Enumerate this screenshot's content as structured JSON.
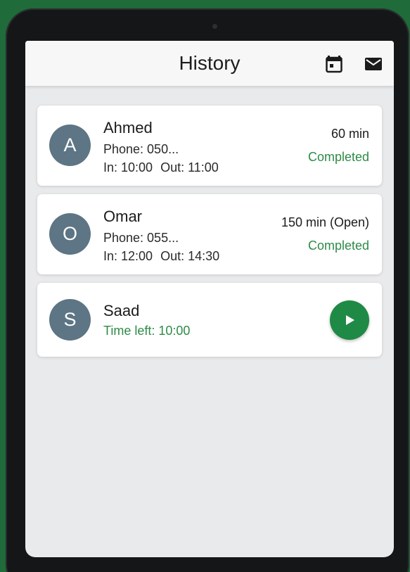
{
  "header": {
    "title": "History",
    "icons": [
      "calendar-icon",
      "mail-icon"
    ]
  },
  "history": [
    {
      "initial": "A",
      "name": "Ahmed",
      "phone": "Phone: 050...",
      "in": "In: 10:00",
      "out": "Out: 11:00",
      "duration": "60 min",
      "status": "Completed"
    },
    {
      "initial": "O",
      "name": "Omar",
      "phone": "Phone: 055...",
      "in": "In: 12:00",
      "out": "Out: 14:30",
      "duration": "150 min (Open)",
      "status": "Completed"
    }
  ],
  "active": {
    "initial": "S",
    "name": "Saad",
    "time_left": "Time left: 10:00",
    "action_icon": "play-icon"
  },
  "colors": {
    "accent_green": "#1f8a45",
    "status_green": "#2e8b47",
    "avatar": "#5d7584",
    "background": "#e8eaec"
  }
}
